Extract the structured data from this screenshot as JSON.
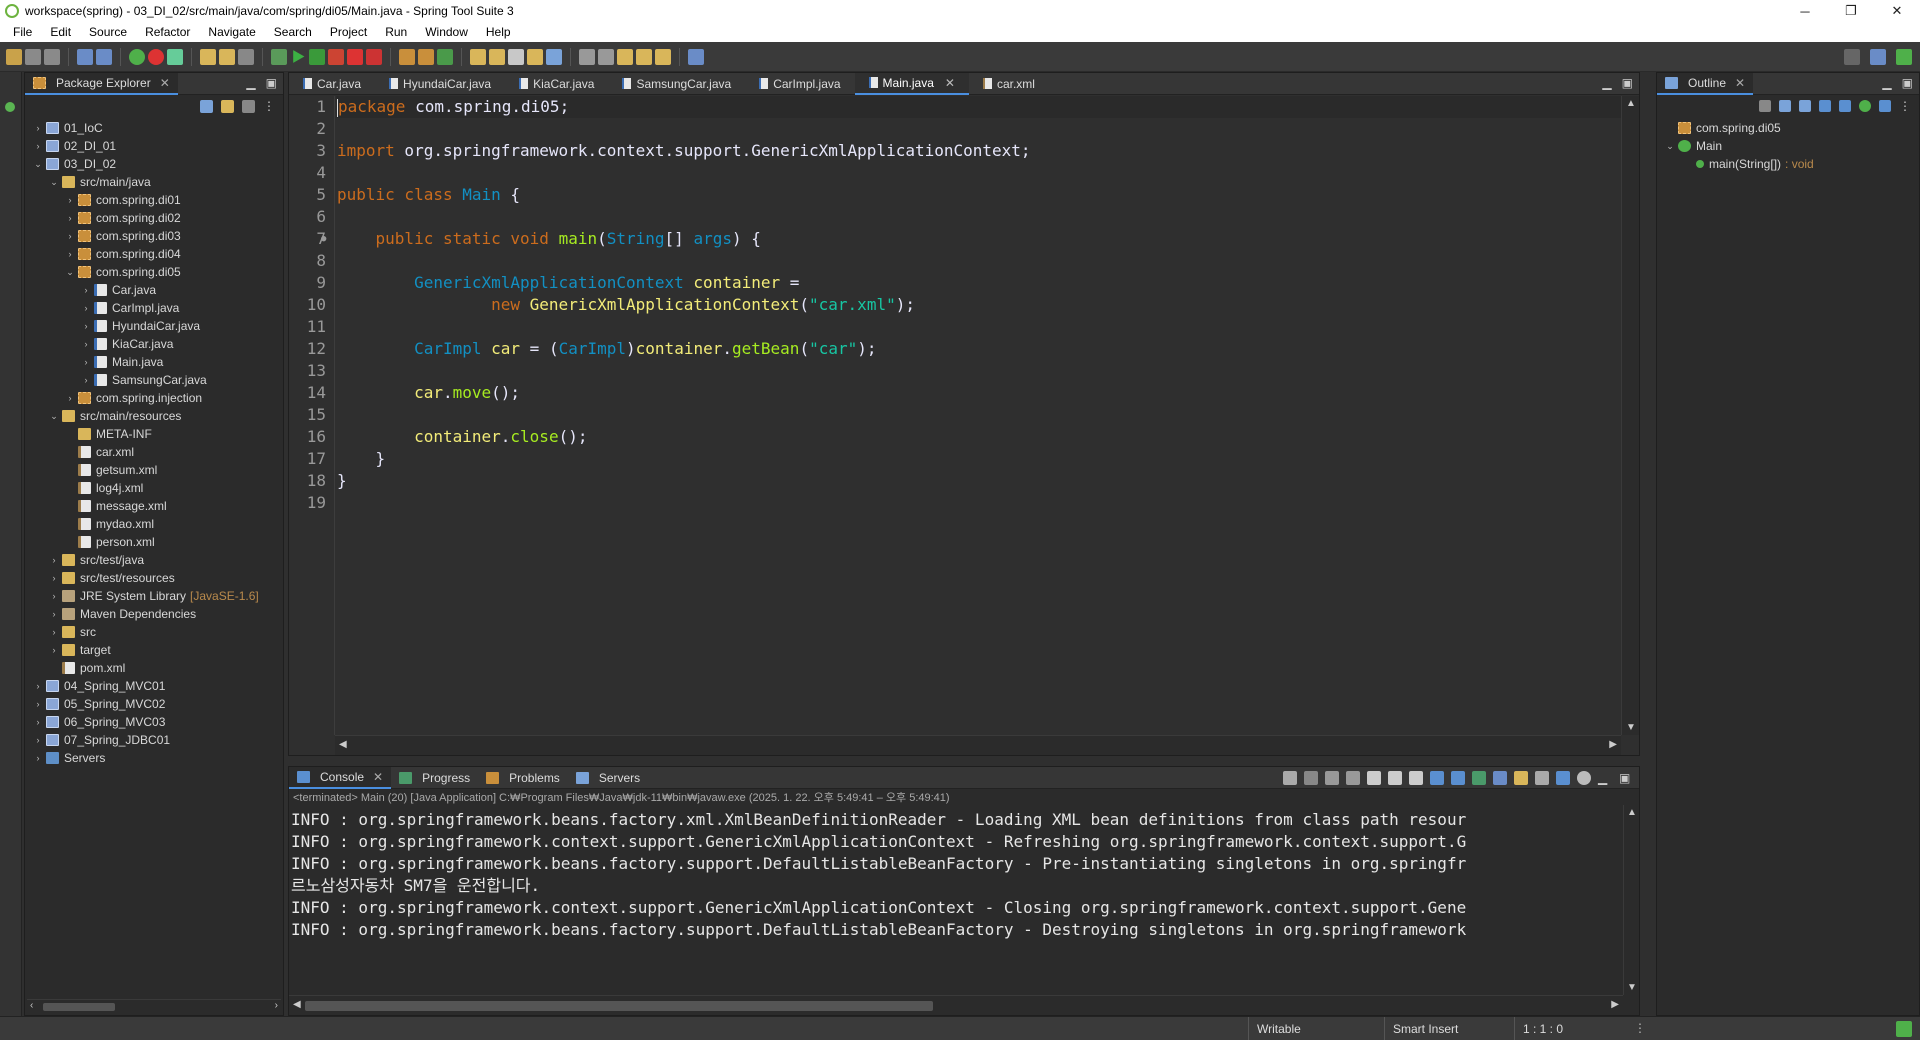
{
  "window": {
    "title": "workspace(spring) - 03_DI_02/src/main/java/com/spring/di05/Main.java - Spring Tool Suite 3",
    "minimize": "─",
    "maximize": "❐",
    "close": "✕"
  },
  "menu": [
    "File",
    "Edit",
    "Source",
    "Refactor",
    "Navigate",
    "Search",
    "Project",
    "Run",
    "Window",
    "Help"
  ],
  "package_explorer": {
    "title": "Package Explorer",
    "items": [
      {
        "label": "01_IoC",
        "depth": 0,
        "icon": "project",
        "twisty": "›"
      },
      {
        "label": "02_DI_01",
        "depth": 0,
        "icon": "project",
        "twisty": "›"
      },
      {
        "label": "03_DI_02",
        "depth": 0,
        "icon": "project",
        "twisty": "⌄"
      },
      {
        "label": "src/main/java",
        "depth": 1,
        "icon": "folder",
        "twisty": "⌄"
      },
      {
        "label": "com.spring.di01",
        "depth": 2,
        "icon": "pkg",
        "twisty": "›"
      },
      {
        "label": "com.spring.di02",
        "depth": 2,
        "icon": "pkg",
        "twisty": "›"
      },
      {
        "label": "com.spring.di03",
        "depth": 2,
        "icon": "pkg",
        "twisty": "›"
      },
      {
        "label": "com.spring.di04",
        "depth": 2,
        "icon": "pkg",
        "twisty": "›"
      },
      {
        "label": "com.spring.di05",
        "depth": 2,
        "icon": "pkg",
        "twisty": "⌄"
      },
      {
        "label": "Car.java",
        "depth": 3,
        "icon": "java",
        "twisty": "›"
      },
      {
        "label": "CarImpl.java",
        "depth": 3,
        "icon": "java",
        "twisty": "›"
      },
      {
        "label": "HyundaiCar.java",
        "depth": 3,
        "icon": "java",
        "twisty": "›"
      },
      {
        "label": "KiaCar.java",
        "depth": 3,
        "icon": "java",
        "twisty": "›"
      },
      {
        "label": "Main.java",
        "depth": 3,
        "icon": "java",
        "twisty": "›"
      },
      {
        "label": "SamsungCar.java",
        "depth": 3,
        "icon": "java",
        "twisty": "›"
      },
      {
        "label": "com.spring.injection",
        "depth": 2,
        "icon": "pkg",
        "twisty": "›"
      },
      {
        "label": "src/main/resources",
        "depth": 1,
        "icon": "folder",
        "twisty": "⌄"
      },
      {
        "label": "META-INF",
        "depth": 2,
        "icon": "folder",
        "twisty": ""
      },
      {
        "label": "car.xml",
        "depth": 2,
        "icon": "xml",
        "twisty": ""
      },
      {
        "label": "getsum.xml",
        "depth": 2,
        "icon": "xml",
        "twisty": ""
      },
      {
        "label": "log4j.xml",
        "depth": 2,
        "icon": "xml",
        "twisty": ""
      },
      {
        "label": "message.xml",
        "depth": 2,
        "icon": "xml",
        "twisty": ""
      },
      {
        "label": "mydao.xml",
        "depth": 2,
        "icon": "xml",
        "twisty": ""
      },
      {
        "label": "person.xml",
        "depth": 2,
        "icon": "xml",
        "twisty": ""
      },
      {
        "label": "src/test/java",
        "depth": 1,
        "icon": "folder",
        "twisty": "›"
      },
      {
        "label": "src/test/resources",
        "depth": 1,
        "icon": "folder",
        "twisty": "›"
      },
      {
        "label": "JRE System Library",
        "depth": 1,
        "icon": "lib",
        "twisty": "›",
        "deco": "[JavaSE-1.6]"
      },
      {
        "label": "Maven Dependencies",
        "depth": 1,
        "icon": "lib",
        "twisty": "›"
      },
      {
        "label": "src",
        "depth": 1,
        "icon": "folder",
        "twisty": "›"
      },
      {
        "label": "target",
        "depth": 1,
        "icon": "folder",
        "twisty": "›"
      },
      {
        "label": "pom.xml",
        "depth": 1,
        "icon": "xml",
        "twisty": ""
      },
      {
        "label": "04_Spring_MVC01",
        "depth": 0,
        "icon": "project",
        "twisty": "›"
      },
      {
        "label": "05_Spring_MVC02",
        "depth": 0,
        "icon": "project",
        "twisty": "›"
      },
      {
        "label": "06_Spring_MVC03",
        "depth": 0,
        "icon": "project",
        "twisty": "›"
      },
      {
        "label": "07_Spring_JDBC01",
        "depth": 0,
        "icon": "project",
        "twisty": "›"
      },
      {
        "label": "Servers",
        "depth": 0,
        "icon": "srv",
        "twisty": "›"
      }
    ]
  },
  "editor": {
    "tabs": [
      {
        "label": "Car.java",
        "kind": "java",
        "active": false
      },
      {
        "label": "HyundaiCar.java",
        "kind": "java",
        "active": false
      },
      {
        "label": "KiaCar.java",
        "kind": "java",
        "active": false
      },
      {
        "label": "SamsungCar.java",
        "kind": "java",
        "active": false
      },
      {
        "label": "CarImpl.java",
        "kind": "java",
        "active": false
      },
      {
        "label": "Main.java",
        "kind": "java",
        "active": true
      },
      {
        "label": "car.xml",
        "kind": "xml",
        "active": false
      }
    ],
    "lines": [
      [
        {
          "t": "package",
          "c": "kw"
        },
        {
          "t": " com.spring.di05;",
          "c": "pn"
        }
      ],
      [],
      [
        {
          "t": "import",
          "c": "kw"
        },
        {
          "t": " org.springframework.context.support.GenericXmlApplicationContext;",
          "c": "pn"
        }
      ],
      [],
      [
        {
          "t": "public class ",
          "c": "kw"
        },
        {
          "t": "Main",
          "c": "ty"
        },
        {
          "t": " {",
          "c": "pn"
        }
      ],
      [],
      [
        {
          "t": "    "
        },
        {
          "t": "public static void ",
          "c": "kw"
        },
        {
          "t": "main",
          "c": "fn"
        },
        {
          "t": "(",
          "c": "pn"
        },
        {
          "t": "String",
          "c": "ty"
        },
        {
          "t": "[] ",
          "c": "pn"
        },
        {
          "t": "args",
          "c": "ty"
        },
        {
          "t": ") {",
          "c": "pn"
        }
      ],
      [],
      [
        {
          "t": "        "
        },
        {
          "t": "GenericXmlApplicationContext",
          "c": "ty"
        },
        {
          "t": " "
        },
        {
          "t": "container",
          "c": "vr"
        },
        {
          "t": " =",
          "c": "pn"
        }
      ],
      [
        {
          "t": "                "
        },
        {
          "t": "new ",
          "c": "kw"
        },
        {
          "t": "GenericXmlApplicationContext",
          "c": "vr"
        },
        {
          "t": "(",
          "c": "pn"
        },
        {
          "t": "\"car.xml\"",
          "c": "st"
        },
        {
          "t": ");",
          "c": "pn"
        }
      ],
      [],
      [
        {
          "t": "        "
        },
        {
          "t": "CarImpl",
          "c": "ty"
        },
        {
          "t": " "
        },
        {
          "t": "car",
          "c": "vr"
        },
        {
          "t": " = (",
          "c": "pn"
        },
        {
          "t": "CarImpl",
          "c": "ty"
        },
        {
          "t": ")",
          "c": "pn"
        },
        {
          "t": "container",
          "c": "vr"
        },
        {
          "t": ".",
          "c": "pn"
        },
        {
          "t": "getBean",
          "c": "fn"
        },
        {
          "t": "(",
          "c": "pn"
        },
        {
          "t": "\"car\"",
          "c": "st"
        },
        {
          "t": ");",
          "c": "pn"
        }
      ],
      [],
      [
        {
          "t": "        "
        },
        {
          "t": "car",
          "c": "vr"
        },
        {
          "t": ".",
          "c": "pn"
        },
        {
          "t": "move",
          "c": "fn"
        },
        {
          "t": "();",
          "c": "pn"
        }
      ],
      [],
      [
        {
          "t": "        "
        },
        {
          "t": "container",
          "c": "vr"
        },
        {
          "t": ".",
          "c": "pn"
        },
        {
          "t": "close",
          "c": "fn"
        },
        {
          "t": "();",
          "c": "pn"
        }
      ],
      [
        {
          "t": "    }",
          "c": "pn"
        }
      ],
      [
        {
          "t": "}",
          "c": "pn"
        }
      ],
      []
    ]
  },
  "outline": {
    "title": "Outline",
    "items": [
      {
        "label": "com.spring.di05",
        "depth": 0,
        "icon": "pkg",
        "twisty": ""
      },
      {
        "label": "Main",
        "depth": 0,
        "icon": "class",
        "twisty": "⌄"
      },
      {
        "label": "main(String[])",
        "depth": 1,
        "icon": "method",
        "twisty": "",
        "ret": ": void"
      }
    ]
  },
  "console": {
    "tabs": [
      "Console",
      "Progress",
      "Problems",
      "Servers"
    ],
    "terminated": "<terminated> Main (20) [Java Application] C:₩Program Files₩Java₩jdk-11₩bin₩javaw.exe  (2025. 1. 22. 오후 5:49:41 – 오후 5:49:41)",
    "lines": [
      "INFO : org.springframework.beans.factory.xml.XmlBeanDefinitionReader - Loading XML bean definitions from class path resour",
      "INFO : org.springframework.context.support.GenericXmlApplicationContext - Refreshing org.springframework.context.support.G",
      "INFO : org.springframework.beans.factory.support.DefaultListableBeanFactory - Pre-instantiating singletons in org.springfr",
      "르노삼성자동차 SM7을 운전합니다.",
      "INFO : org.springframework.context.support.GenericXmlApplicationContext - Closing org.springframework.context.support.Gene",
      "INFO : org.springframework.beans.factory.support.DefaultListableBeanFactory - Destroying singletons in org.springframework"
    ]
  },
  "status": {
    "writable": "Writable",
    "insert_mode": "Smart Insert",
    "position": "1 : 1 : 0"
  },
  "colors": {
    "background": "#2f2f2f",
    "keyword": "#cc6c1d",
    "type": "#1290c3",
    "variable": "#f3ec79",
    "string": "#17c6a3",
    "method": "#a7ec21",
    "active_tab_accent": "#4a8fe0"
  }
}
